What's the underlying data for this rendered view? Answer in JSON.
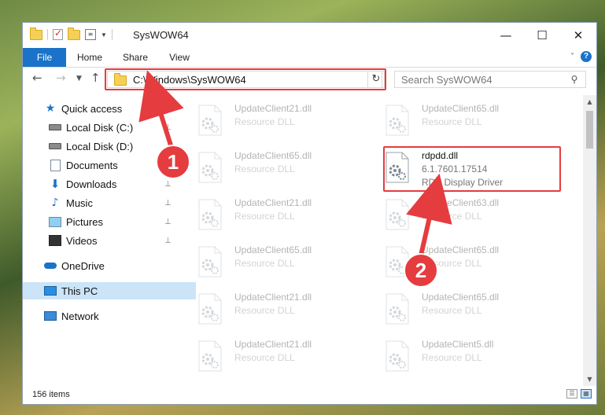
{
  "window": {
    "title": "SysWOW64"
  },
  "ribbon": {
    "tabs": [
      "File",
      "Home",
      "Share",
      "View"
    ],
    "help_glyph": "?"
  },
  "nav": {
    "address": "C:\\Windows\\SysWOW64",
    "search_placeholder": "Search SysWOW64"
  },
  "sidebar": {
    "items": [
      {
        "label": "Quick access",
        "icon": "star-icon"
      },
      {
        "label": "Local Disk (C:)",
        "icon": "disk-icon"
      },
      {
        "label": "Local Disk (D:)",
        "icon": "disk-icon"
      },
      {
        "label": "Documents",
        "icon": "documents-icon"
      },
      {
        "label": "Downloads",
        "icon": "downloads-icon"
      },
      {
        "label": "Music",
        "icon": "music-icon"
      },
      {
        "label": "Pictures",
        "icon": "pictures-icon"
      },
      {
        "label": "Videos",
        "icon": "videos-icon"
      },
      {
        "label": "OneDrive",
        "icon": "onedrive-icon"
      },
      {
        "label": "This PC",
        "icon": "this-pc-icon"
      },
      {
        "label": "Network",
        "icon": "network-icon"
      }
    ]
  },
  "files": {
    "items": [
      {
        "name": "UpdateClient21.dll",
        "desc": "Resource DLL"
      },
      {
        "name": "UpdateClient65.dll",
        "desc": "Resource DLL"
      },
      {
        "name": "UpdateClient65.dll",
        "desc": "Resource DLL"
      },
      {
        "name": "rdpdd.dll",
        "version": "6.1.7601.17514",
        "desc": "RDP Display Driver"
      },
      {
        "name": "UpdateClient21.dll",
        "desc": "Resource DLL"
      },
      {
        "name": "UpdateClient63.dll",
        "desc": "Resource DLL"
      },
      {
        "name": "UpdateClient65.dll",
        "desc": "Resource DLL"
      },
      {
        "name": "UpdateClient65.dll",
        "desc": "Resource DLL"
      },
      {
        "name": "UpdateClient21.dll",
        "desc": "Resource DLL"
      },
      {
        "name": "UpdateClient65.dll",
        "desc": "Resource DLL"
      },
      {
        "name": "UpdateClient21.dll",
        "desc": "Resource DLL"
      },
      {
        "name": "UpdateClient5.dll",
        "desc": "Resource DLL"
      }
    ]
  },
  "status": {
    "count": "156 items"
  },
  "annotations": {
    "marker1": "1",
    "marker2": "2"
  },
  "colors": {
    "accent": "#1a73c8",
    "highlight": "#e53c3f",
    "selected": "#cce4f7"
  }
}
